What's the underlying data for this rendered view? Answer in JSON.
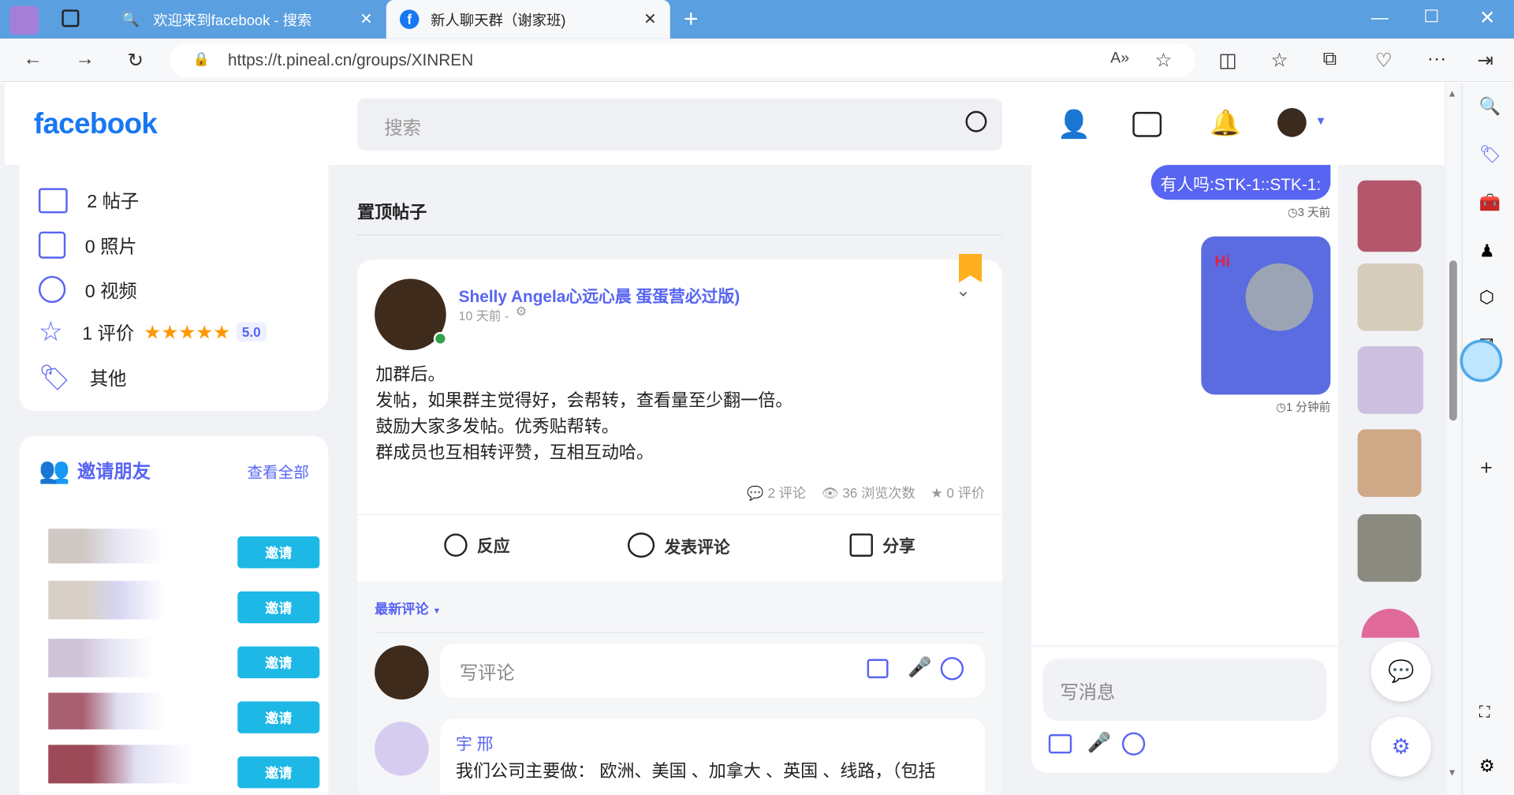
{
  "browser": {
    "tabs": [
      {
        "title": "欢迎来到facebook - 搜索"
      },
      {
        "title": "新人聊天群（谢家班)"
      }
    ],
    "url": "https://t.pineal.cn/groups/XINREN"
  },
  "header": {
    "logo": "facebook",
    "search_placeholder": "搜索"
  },
  "left": {
    "stats": [
      {
        "count": "2 帖子",
        "icon": "posts-icon"
      },
      {
        "count": "0 照片",
        "icon": "photos-icon"
      },
      {
        "count": "0 视频",
        "icon": "video-icon"
      },
      {
        "count": "1 评价",
        "icon": "star-icon",
        "rating": "5.0",
        "stars": 5
      },
      {
        "count": "其他",
        "icon": "tag-icon"
      }
    ],
    "invite_title": "邀请朋友",
    "invite_view_all": "查看全部",
    "invite_button": "邀请"
  },
  "main": {
    "pinned_title": "置顶帖子",
    "post": {
      "author": "Shelly Angela心远心晨 蛋蛋营必过版)",
      "time": "10 天前 -",
      "lines": [
        "加群后。",
        "发帖，如果群主觉得好，会帮转，查看量至少翻一倍。",
        "鼓励大家多发帖。优秀贴帮转。",
        "群成员也互相转评赞，互相互动哈。"
      ],
      "comments": "2 评论",
      "views": "36 浏览次数",
      "ratings": "0 评价",
      "react_label": "反应",
      "comment_label": "发表评论",
      "share_label": "分享",
      "sort_label": "最新评论",
      "comment_placeholder": "写评论",
      "first_comment_author": "宇 邢",
      "first_comment_text": "我们公司主要做： 欧洲、美国 、加拿大 、英国 、线路，（包括"
    }
  },
  "chat": {
    "msg1": "有人吗:STK-1::STK-1:",
    "time1": "3 天前",
    "time2": "1 分钟前",
    "input_placeholder": "写消息"
  },
  "colors": {
    "brand": "#1877f2",
    "accent": "#5865f2",
    "invite": "#1db8e6",
    "star": "#ff9800"
  }
}
